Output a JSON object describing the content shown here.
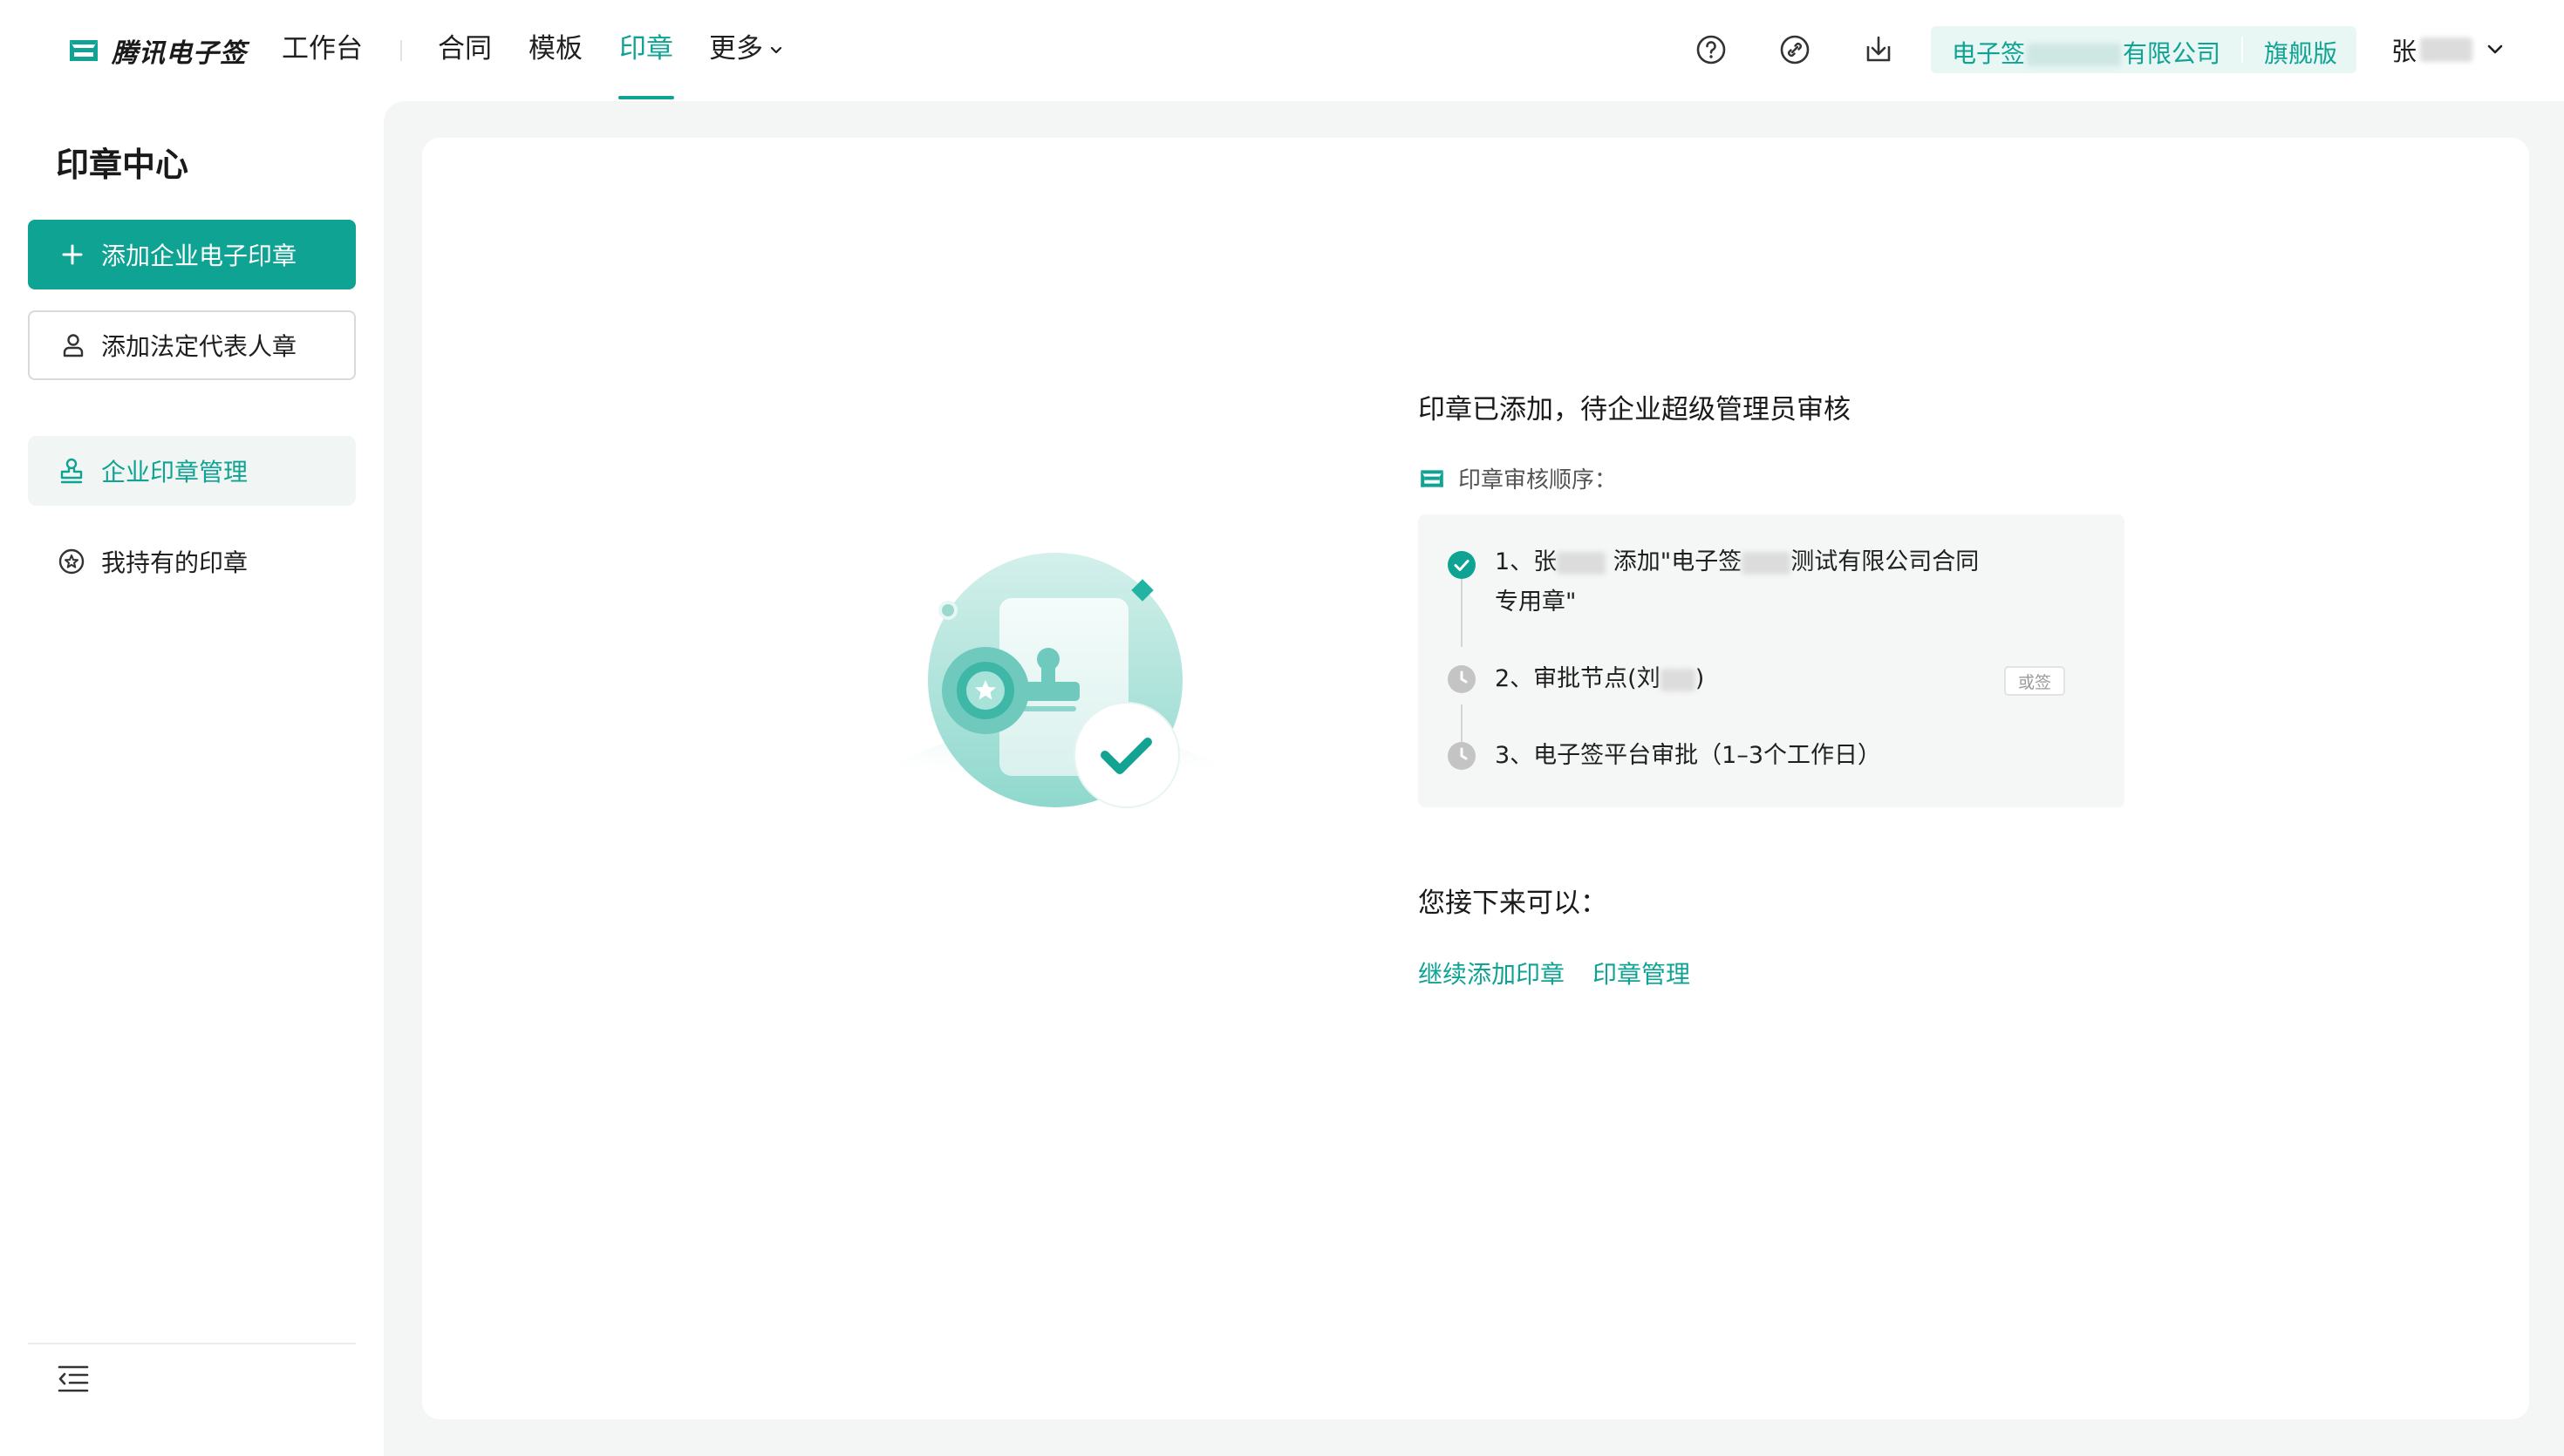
{
  "brand": {
    "name": "腾讯电子签",
    "accent": "#0fa394"
  },
  "nav": {
    "workbench": "工作台",
    "items": [
      {
        "label": "合同"
      },
      {
        "label": "模板"
      },
      {
        "label": "印章",
        "active": true
      },
      {
        "label": "更多"
      }
    ]
  },
  "header": {
    "icons": [
      "help-icon",
      "link-icon",
      "download-icon"
    ],
    "company": {
      "prefix": "电子签",
      "suffix": "有限公司"
    },
    "edition": "旗舰版",
    "user_initial": "张"
  },
  "sidebar": {
    "title": "印章中心",
    "add_company_seal": "添加企业电子印章",
    "add_legal_seal": "添加法定代表人章",
    "items": [
      {
        "label": "企业印章管理",
        "active": true
      },
      {
        "label": "我持有的印章"
      }
    ]
  },
  "result": {
    "title": "印章已添加，待企业超级管理员审核",
    "order_label": "印章审核顺序：",
    "steps": [
      {
        "prefix": "1、张",
        "middle": " 添加\"电子签",
        "suffix": "测试有限公司合同",
        "line2": "专用章\"",
        "status": "done"
      },
      {
        "prefix": "2、审批节点(刘",
        "suffix": ")",
        "tag": "或签",
        "status": "pending"
      },
      {
        "text": "3、电子签平台审批（1–3个工作日）",
        "status": "pending"
      }
    ],
    "next_title": "您接下来可以：",
    "links": [
      "继续添加印章",
      "印章管理"
    ]
  }
}
